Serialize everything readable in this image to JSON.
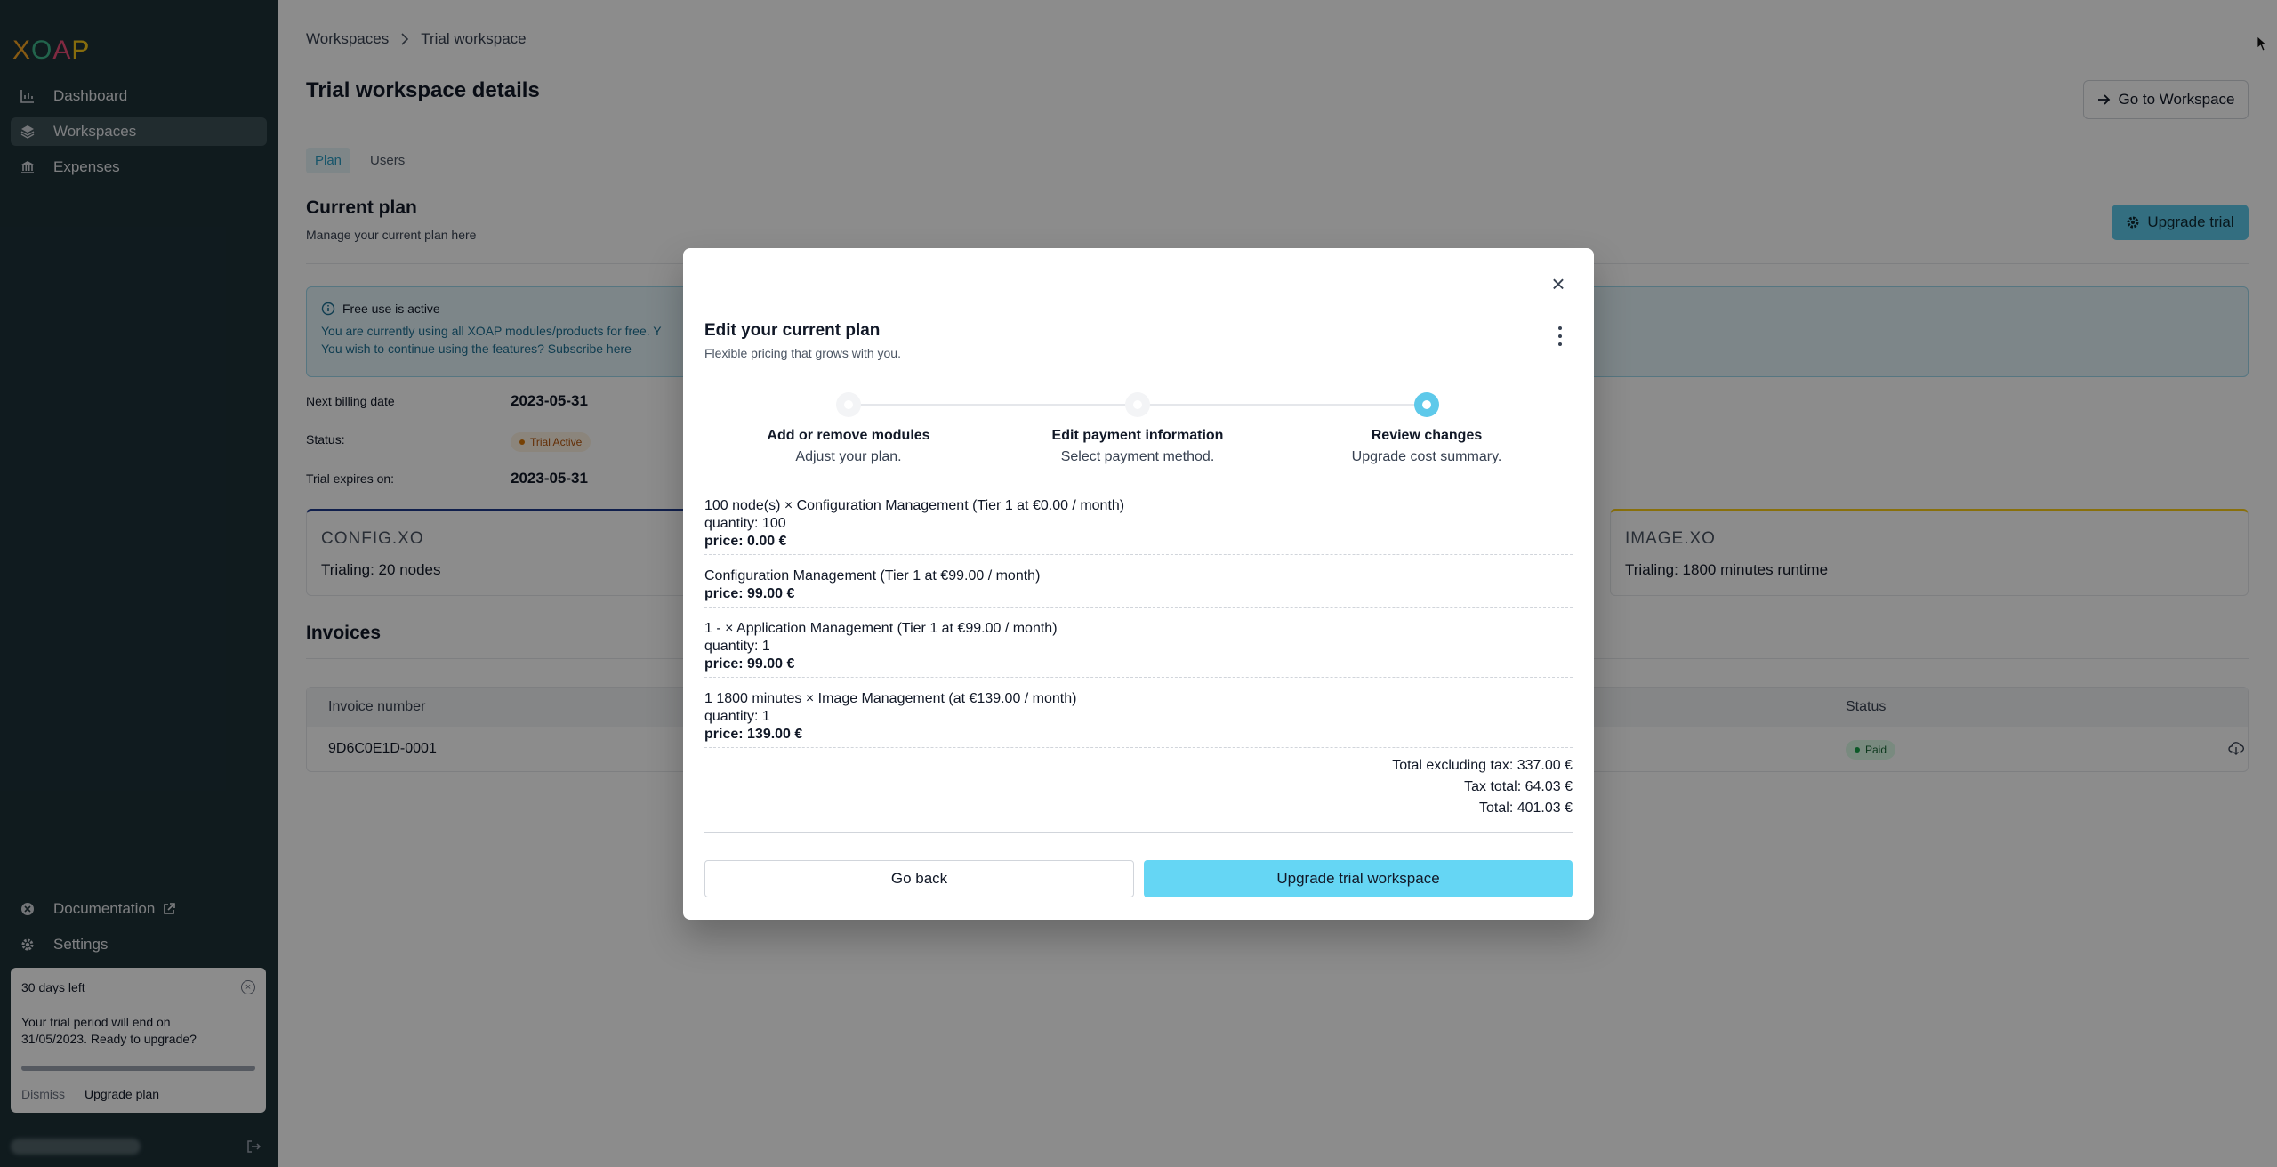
{
  "sidebar": {
    "logo": [
      "X",
      "O",
      "A",
      "P"
    ],
    "logo_colors": [
      "#f5a524",
      "#3fb68b",
      "#e94e77",
      "#f5c518"
    ],
    "nav": [
      {
        "label": "Dashboard",
        "icon": "chart-icon"
      },
      {
        "label": "Workspaces",
        "icon": "layers-icon"
      },
      {
        "label": "Expenses",
        "icon": "bank-icon"
      }
    ],
    "bottom_nav": [
      {
        "label": "Documentation",
        "icon": "docs-icon"
      },
      {
        "label": "Settings",
        "icon": "gear-icon"
      }
    ],
    "trial_card": {
      "days_left": "30 days left",
      "message": "Your trial period will end on 31/05/2023. Ready to upgrade?",
      "progress": 1.0,
      "dismiss": "Dismiss",
      "upgrade": "Upgrade plan"
    }
  },
  "main": {
    "breadcrumb": [
      "Workspaces",
      "Trial workspace"
    ],
    "title": "Trial workspace details",
    "goto_button": "Go to Workspace",
    "tabs": [
      "Plan",
      "Users"
    ],
    "section_title": "Current plan",
    "section_sub": "Manage your current plan here",
    "upgrade_trial": "Upgrade trial",
    "info": {
      "title": "Free use is active",
      "line1": "You are currently using all XOAP modules/products for free. Y",
      "line2": "You wish to continue using the features? Subscribe here"
    },
    "details": {
      "billing_label": "Next billing date",
      "billing_value": "2023-05-31",
      "status_label": "Status:",
      "status_value": "Trial Active",
      "expires_label": "Trial expires on:",
      "expires_value": "2023-05-31"
    },
    "products": [
      {
        "logo": "CONFIG.XO",
        "trialing": "Trialing: 20 nodes",
        "accent": "#1e3a8a"
      },
      {
        "logo": "IMAGE.XO",
        "trialing": "Trialing: 1800 minutes runtime",
        "accent": "#facc15"
      }
    ],
    "invoices_title": "Invoices",
    "invoice_table": {
      "headers": [
        "Invoice number",
        "Status"
      ],
      "rows": [
        {
          "number": "9D6C0E1D-0001",
          "status": "Paid"
        }
      ]
    }
  },
  "modal": {
    "title": "Edit your current plan",
    "subtitle": "Flexible pricing that grows with you.",
    "steps": [
      {
        "title": "Add or remove modules",
        "desc": "Adjust your plan."
      },
      {
        "title": "Edit payment information",
        "desc": "Select payment method."
      },
      {
        "title": "Review changes",
        "desc": "Upgrade cost summary."
      }
    ],
    "line_items": [
      {
        "name": "100 node(s) × Configuration Management (Tier 1 at €0.00 / month)",
        "quantity": "quantity: 100",
        "price": "price: 0.00 €"
      },
      {
        "name": "Configuration Management (Tier 1 at €99.00 / month)",
        "quantity": "",
        "price": "price: 99.00 €"
      },
      {
        "name": "1 - × Application Management (Tier 1 at €99.00 / month)",
        "quantity": "quantity: 1",
        "price": "price: 99.00 €"
      },
      {
        "name": "1 1800 minutes × Image Management (at €139.00 / month)",
        "quantity": "quantity: 1",
        "price": "price: 139.00 €"
      }
    ],
    "totals": {
      "excl_tax": "Total excluding tax: 337.00 €",
      "tax": "Tax total: 64.03 €",
      "total": "Total: 401.03 €"
    },
    "go_back": "Go back",
    "upgrade": "Upgrade trial workspace"
  }
}
